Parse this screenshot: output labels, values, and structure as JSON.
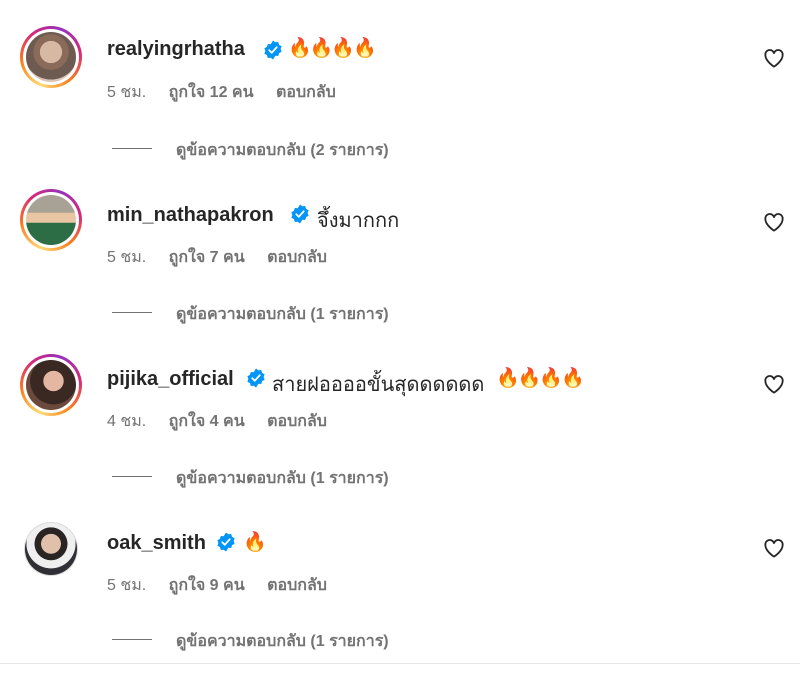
{
  "comments": [
    {
      "username": "realyingrhatha",
      "text": "",
      "emoji": "🔥🔥🔥🔥",
      "time": "5 ชม.",
      "likes": "ถูกใจ 12 คน",
      "reply": "ตอบกลับ",
      "view_replies": "ดูข้อความตอบกลับ (2 รายการ)",
      "story_ring": true
    },
    {
      "username": "min_nathapakron",
      "text": "จึ้งมากกก",
      "emoji": "",
      "time": "5 ชม.",
      "likes": "ถูกใจ 7 คน",
      "reply": "ตอบกลับ",
      "view_replies": "ดูข้อความตอบกลับ (1 รายการ)",
      "story_ring": true
    },
    {
      "username": "pijika_official",
      "text": "สายฝออออขั้นสุดดดดดด",
      "emoji": "🔥🔥🔥🔥",
      "time": "4 ชม.",
      "likes": "ถูกใจ 4 คน",
      "reply": "ตอบกลับ",
      "view_replies": "ดูข้อความตอบกลับ (1 รายการ)",
      "story_ring": true
    },
    {
      "username": "oak_smith",
      "text": "",
      "emoji": "🔥",
      "time": "5 ชม.",
      "likes": "ถูกใจ 9 คน",
      "reply": "ตอบกลับ",
      "view_replies": "ดูข้อความตอบกลับ (1 รายการ)",
      "story_ring": false
    }
  ],
  "icons": {
    "verified": "verified-badge-icon",
    "like": "heart-outline-icon"
  },
  "colors": {
    "verified_blue": "#0095f6",
    "text_primary": "#262626",
    "text_secondary": "#737373"
  }
}
